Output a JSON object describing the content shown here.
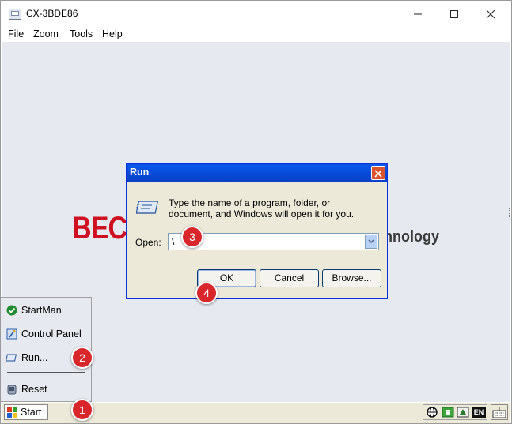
{
  "window": {
    "title": "CX-3BDE86",
    "controls": {
      "minimize": "—",
      "maximize": "☐",
      "close": "✕"
    }
  },
  "menu": [
    "File",
    "Zoom",
    "Tools",
    "Help"
  ],
  "desktop": {
    "logo_left": "BEC",
    "logo_right": "nnology",
    "logo_color": "#d01020"
  },
  "run_dialog": {
    "title": "Run",
    "message": "Type the name of a program, folder, or document, and Windows will open it for you.",
    "open_label": "Open:",
    "open_value": "\\",
    "buttons": {
      "ok": "OK",
      "cancel": "Cancel",
      "browse": "Browse..."
    },
    "title_color": "#0a58ea"
  },
  "start_menu": {
    "items": [
      {
        "label": "StartMan",
        "icon": "green-check-icon"
      },
      {
        "label": "Control Panel",
        "icon": "control-panel-icon"
      },
      {
        "label": "Run...",
        "icon": "run-icon"
      },
      {
        "label": "Reset",
        "icon": "reset-icon"
      }
    ]
  },
  "taskbar": {
    "start_label": "Start",
    "tray_lang": "EN"
  },
  "callouts": [
    "1",
    "2",
    "3",
    "4"
  ]
}
